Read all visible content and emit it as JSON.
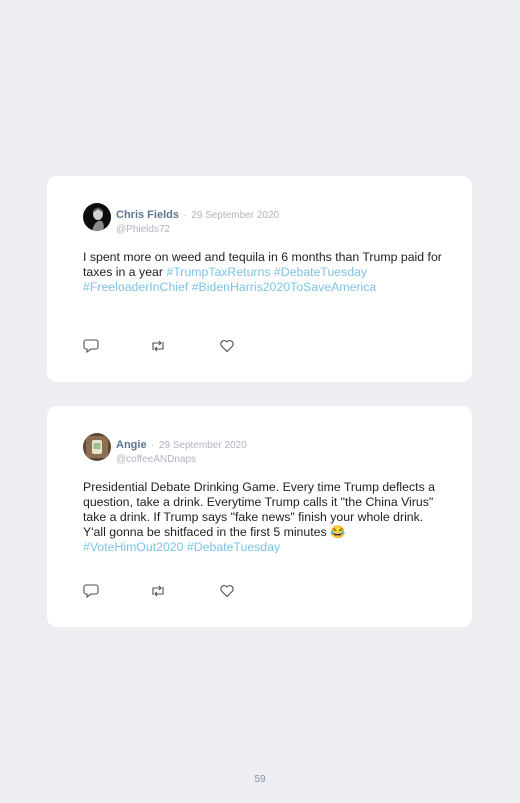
{
  "tweets": [
    {
      "name": "Chris Fields",
      "separator": "·",
      "date": "29 September 2020",
      "handle": "@Phields72",
      "text": "I spent more on weed and tequila in 6 months than Trump paid for taxes in a year ",
      "hashtags": [
        "#TrumpTaxReturns",
        "#DebateTuesday",
        "#FreeloaderInChief",
        "#BidenHarris2020ToSaveAmerica"
      ]
    },
    {
      "name": "Angie",
      "separator": "·",
      "date": "29 September 2020",
      "handle": "@coffeeANDnaps",
      "text": "Presidential Debate Drinking Game. Every time Trump deflects a question, take a drink. Everytime Trump calls it \"the China Virus\" take a drink. If Trump says \"fake news\" finish your whole drink. Y'all gonna be shitfaced in the first 5 minutes 😂 ",
      "hashtags": [
        "#VoteHimOut2020",
        "#DebateTuesday"
      ]
    }
  ],
  "icons": [
    "reply-icon",
    "retweet-icon",
    "like-icon"
  ],
  "colors": {
    "hashtag": "#7cc3e6",
    "name": "#5f7590",
    "muted": "#aeb5bf",
    "background": "#eceef2"
  },
  "page_number": "59"
}
